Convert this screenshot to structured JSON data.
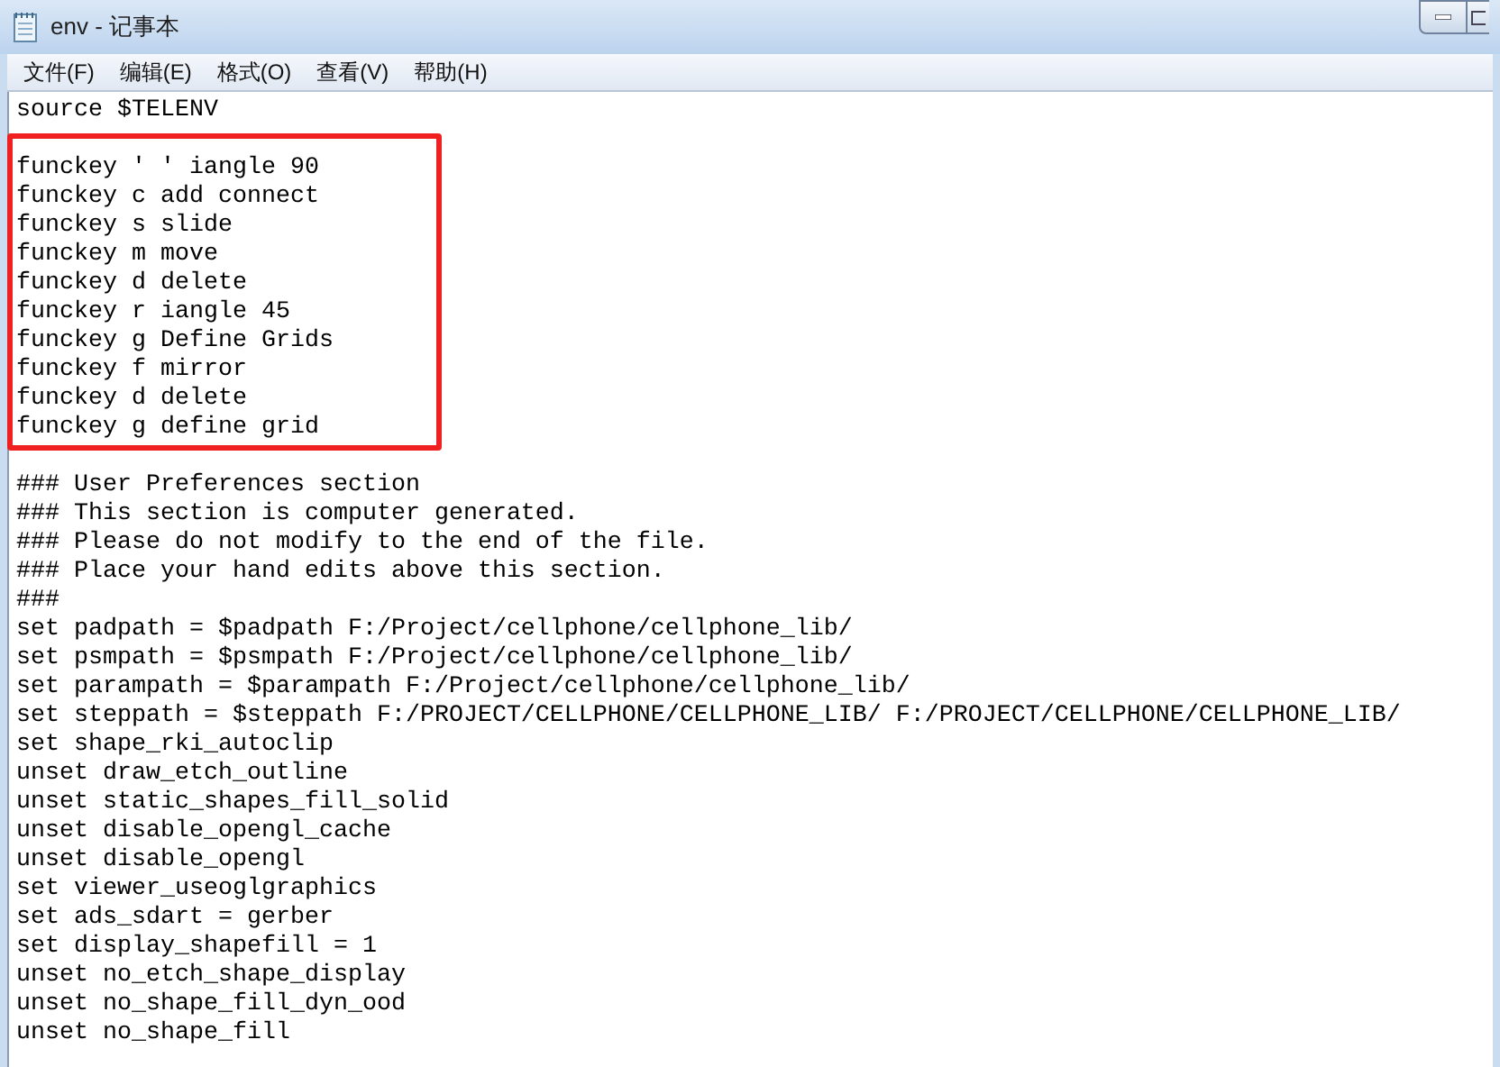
{
  "window": {
    "title": "env - 记事本"
  },
  "menu": [
    {
      "label": "文件(F)"
    },
    {
      "label": "编辑(E)"
    },
    {
      "label": "格式(O)"
    },
    {
      "label": "查看(V)"
    },
    {
      "label": "帮助(H)"
    }
  ],
  "editor": {
    "blocks": [
      {
        "highlighted": false,
        "lines": [
          "source $TELENV"
        ]
      },
      {
        "highlighted": true,
        "lines": [
          "funckey ' ' iangle 90",
          "funckey c add connect",
          "funckey s slide",
          "funckey m move",
          "funckey d delete",
          "funckey r iangle 45",
          "funckey g Define Grids",
          "funckey f mirror",
          "funckey d delete",
          "funckey g define grid"
        ]
      },
      {
        "highlighted": false,
        "lines": [
          "### User Preferences section",
          "### This section is computer generated.",
          "### Please do not modify to the end of the file.",
          "### Place your hand edits above this section.",
          "###",
          "set padpath = $padpath F:/Project/cellphone/cellphone_lib/",
          "set psmpath = $psmpath F:/Project/cellphone/cellphone_lib/",
          "set parampath = $parampath F:/Project/cellphone/cellphone_lib/",
          "set steppath = $steppath F:/PROJECT/CELLPHONE/CELLPHONE_LIB/ F:/PROJECT/CELLPHONE/CELLPHONE_LIB/",
          "set shape_rki_autoclip",
          "unset draw_etch_outline",
          "unset static_shapes_fill_solid",
          "unset disable_opengl_cache",
          "unset disable_opengl",
          "set viewer_useoglgraphics",
          "set ads_sdart = gerber",
          "set display_shapefill = 1",
          "unset no_etch_shape_display",
          "unset no_shape_fill_dyn_ood",
          "unset no_shape_fill"
        ]
      }
    ]
  }
}
